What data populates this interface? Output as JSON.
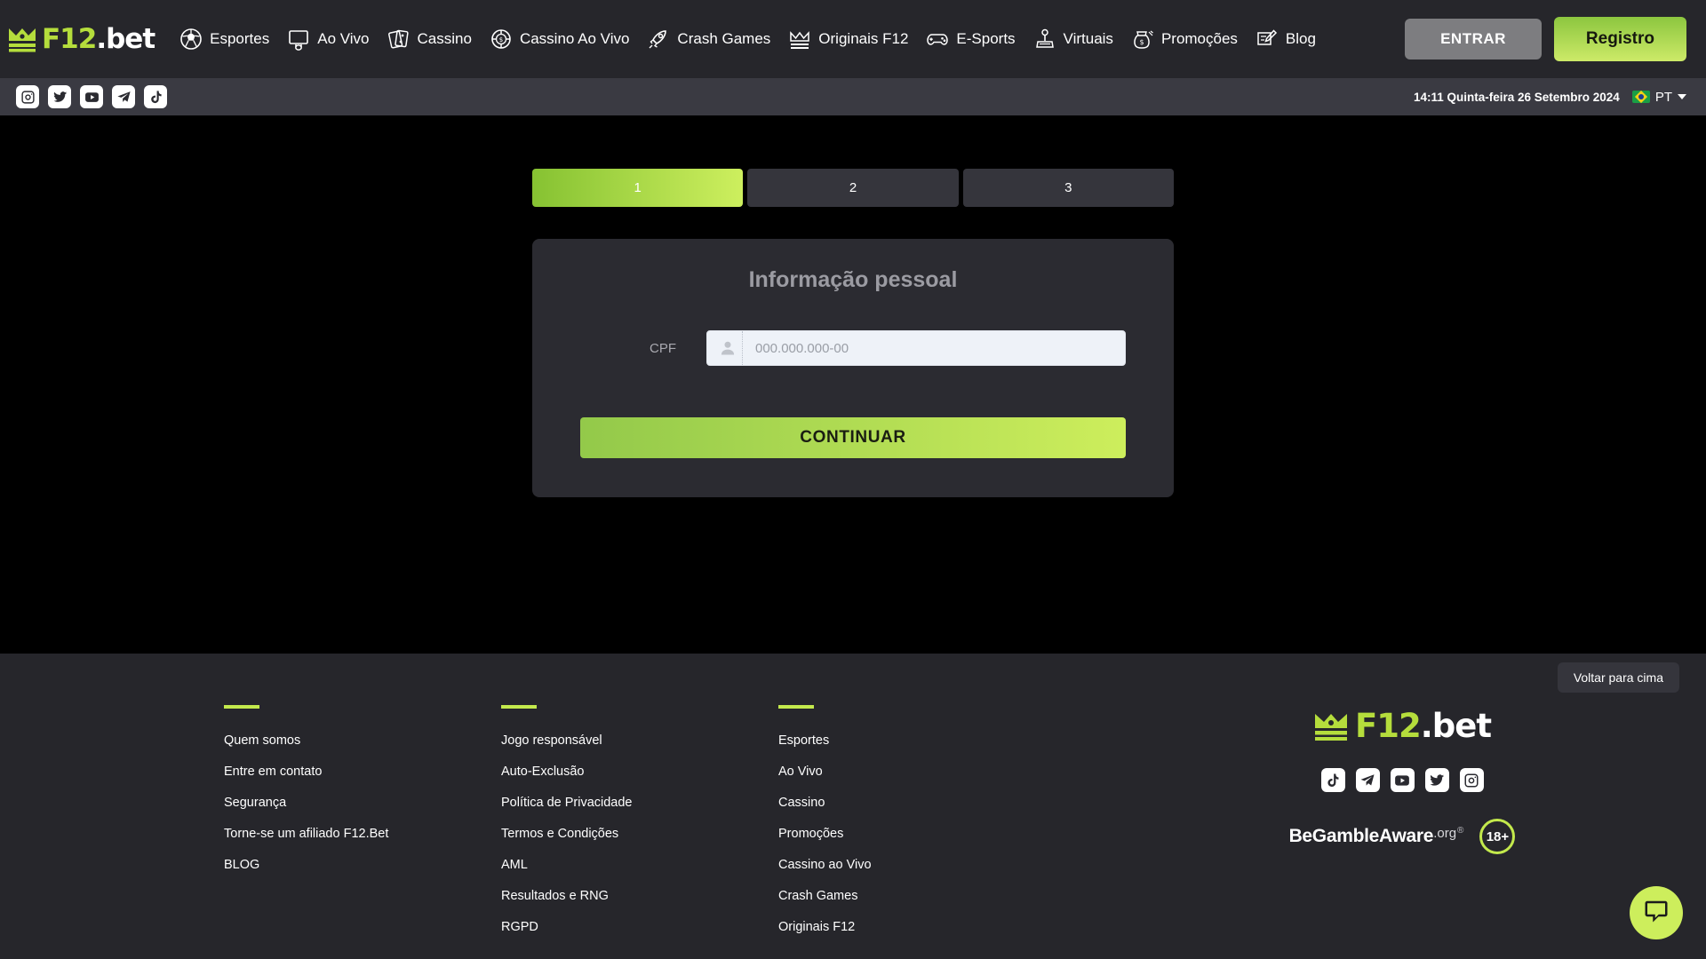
{
  "brand": {
    "logo_left": "F12",
    "logo_right": ".bet",
    "logo_mark": "crown-icon"
  },
  "topnav": {
    "items": [
      {
        "label": "Esportes",
        "icon": "soccer-ball-icon"
      },
      {
        "label": "Ao Vivo",
        "icon": "live-tv-icon"
      },
      {
        "label": "Cassino",
        "icon": "playing-cards-icon"
      },
      {
        "label": "Cassino Ao Vivo",
        "icon": "casino-chip-icon"
      },
      {
        "label": "Crash Games",
        "icon": "rocket-icon"
      },
      {
        "label": "Originais F12",
        "icon": "crown-originals-icon"
      },
      {
        "label": "E-Sports",
        "icon": "gamepad-icon"
      },
      {
        "label": "Virtuais",
        "icon": "joystick-icon"
      },
      {
        "label": "Promoções",
        "icon": "money-bag-icon"
      },
      {
        "label": "Blog",
        "icon": "pencil-note-icon"
      }
    ],
    "login_label": "ENTRAR",
    "register_label": "Registro"
  },
  "subbar": {
    "socials": [
      {
        "name": "instagram-icon"
      },
      {
        "name": "twitter-icon"
      },
      {
        "name": "youtube-icon"
      },
      {
        "name": "telegram-icon"
      },
      {
        "name": "tiktok-icon"
      }
    ],
    "datetime": "14:11 Quinta-feira 26 Setembro 2024",
    "language": "PT",
    "flag": "brazil-flag-icon"
  },
  "register": {
    "steps": [
      {
        "label": "1",
        "active": true
      },
      {
        "label": "2",
        "active": false
      },
      {
        "label": "3",
        "active": false
      }
    ],
    "card_title": "Informação pessoal",
    "cpf_label": "CPF",
    "cpf_value": "",
    "cpf_placeholder": "000.000.000-00",
    "continue_label": "CONTINUAR"
  },
  "footer": {
    "back_to_top": "Voltar para cima",
    "columns": [
      {
        "links": [
          "Quem somos",
          "Entre em contato",
          "Segurança",
          "Torne-se um afiliado F12.Bet",
          "BLOG"
        ]
      },
      {
        "links": [
          "Jogo responsável",
          "Auto-Exclusão",
          "Política de Privacidade",
          "Termos e Condições",
          "AML",
          "Resultados e RNG",
          "RGPD"
        ]
      },
      {
        "links": [
          "Esportes",
          "Ao Vivo",
          "Cassino",
          "Promoções",
          "Cassino ao Vivo",
          "Crash Games",
          "Originais F12"
        ]
      }
    ],
    "socials": [
      {
        "name": "tiktok-icon"
      },
      {
        "name": "telegram-icon"
      },
      {
        "name": "youtube-icon"
      },
      {
        "name": "twitter-icon"
      },
      {
        "name": "instagram-icon"
      }
    ],
    "begambleaware": "BeGambleAware",
    "begambleaware_org": ".org",
    "begambleaware_reg": "®",
    "age_badge": "18+"
  },
  "chat": {
    "icon": "chat-bubble-icon"
  },
  "colors": {
    "accent_green": "#c3e94c",
    "accent_gradient_start": "#8cc63f",
    "accent_gradient_end": "#cdee5c",
    "nav_bg": "#26262b",
    "subbar_bg": "#3a3a42",
    "card_bg": "#2b2b31",
    "main_bg": "#000000"
  }
}
